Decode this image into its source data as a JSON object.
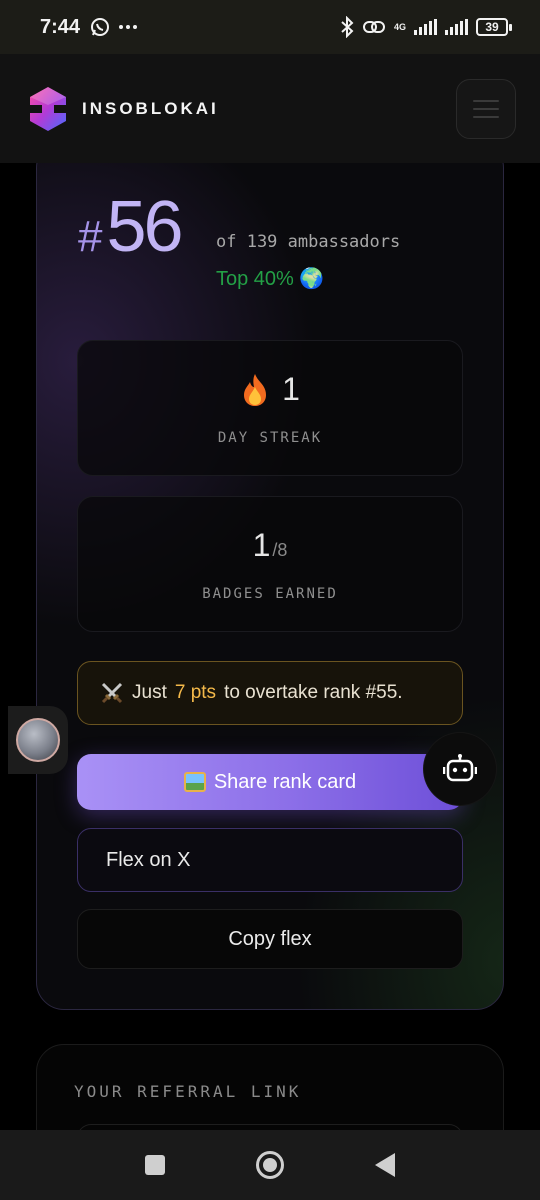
{
  "status_bar": {
    "time": "7:44",
    "battery": "39",
    "network": "4G",
    "icons": [
      "whatsapp-icon",
      "more-icon",
      "bluetooth-icon",
      "link-icon",
      "signal-icon",
      "signal-icon",
      "battery-icon"
    ]
  },
  "app": {
    "brand": "INSOBLOKAI",
    "icons": [
      "logo-icon",
      "menu-icon"
    ]
  },
  "rank": {
    "hash": "#",
    "number": "56",
    "of_text": "of 139 ambassadors",
    "top_text": "Top 40% 🌍"
  },
  "streak": {
    "value": "1",
    "label": "DAY STREAK",
    "icon": "flame-icon"
  },
  "badges": {
    "earned": "1",
    "total": "/8",
    "label": "BADGES EARNED"
  },
  "overtake": {
    "prefix": "Just",
    "points": "7 pts",
    "suffix": "to overtake rank #55.",
    "icon": "crossed-swords-icon"
  },
  "buttons": {
    "share": "Share rank card",
    "flex": "Flex on X",
    "copy": "Copy flex"
  },
  "referral": {
    "label": "YOUR REFERRAL LINK"
  },
  "colors": {
    "accent": "#9b82f0",
    "rank": "#c1b4f4",
    "top_green": "#23a046",
    "points_gold": "#f4b94a"
  }
}
